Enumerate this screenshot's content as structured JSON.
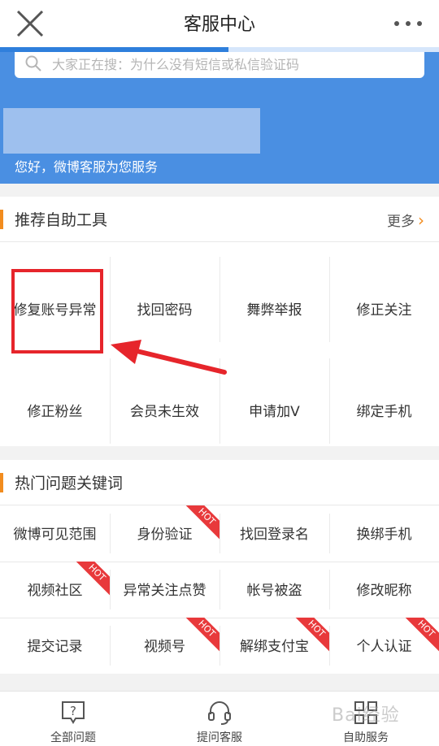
{
  "header": {
    "title": "客服中心"
  },
  "progress": {
    "fraction": 0.52
  },
  "search": {
    "placeholder": "大家正在搜：为什么没有短信或私信验证码"
  },
  "banner": {
    "greeting": "您好，微博客服为您服务"
  },
  "tools": {
    "title": "推荐自助工具",
    "more": "更多",
    "items": [
      {
        "label": "修复账号异常"
      },
      {
        "label": "找回密码"
      },
      {
        "label": "舞弊举报"
      },
      {
        "label": "修正关注"
      },
      {
        "label": "修正粉丝"
      },
      {
        "label": "会员未生效"
      },
      {
        "label": "申请加V"
      },
      {
        "label": "绑定手机"
      }
    ]
  },
  "keywords": {
    "title": "热门问题关键词",
    "hot_badge": "HOT",
    "items": [
      {
        "label": "微博可见范围",
        "hot": false
      },
      {
        "label": "身份验证",
        "hot": true
      },
      {
        "label": "找回登录名",
        "hot": false
      },
      {
        "label": "换绑手机",
        "hot": false
      },
      {
        "label": "视频社区",
        "hot": true
      },
      {
        "label": "异常关注点赞",
        "hot": false
      },
      {
        "label": "帐号被盗",
        "hot": false
      },
      {
        "label": "修改昵称",
        "hot": false
      },
      {
        "label": "提交记录",
        "hot": false
      },
      {
        "label": "视频号",
        "hot": true
      },
      {
        "label": "解绑支付宝",
        "hot": true
      },
      {
        "label": "个人认证",
        "hot": true
      }
    ]
  },
  "tabbar": {
    "items": [
      {
        "label": "全部问题",
        "icon": "question-bubble-icon"
      },
      {
        "label": "提问客服",
        "icon": "headset-icon"
      },
      {
        "label": "自助服务",
        "icon": "grid-apps-icon"
      }
    ]
  },
  "watermark": "Bai经验",
  "colors": {
    "accent": "#f28c1e",
    "banner": "#4a8fe2",
    "hot": "#e8393b",
    "highlight": "#e6252b"
  }
}
